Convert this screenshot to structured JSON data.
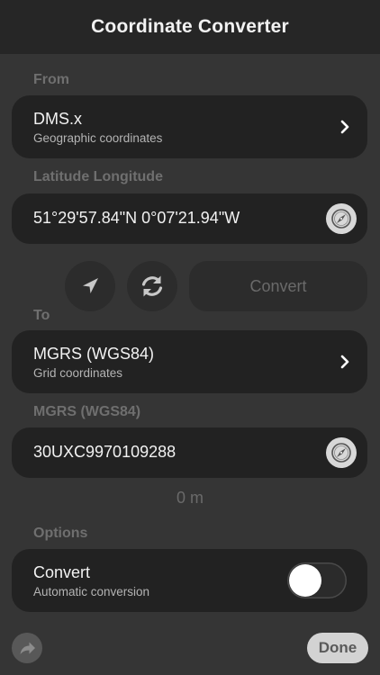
{
  "header": {
    "title": "Coordinate Converter"
  },
  "from": {
    "section_label": "From",
    "format_title": "DMS.x",
    "format_subtitle": "Geographic coordinates",
    "field_label": "Latitude Longitude",
    "value": "51°29'57.84\"N 0°07'21.94\"W"
  },
  "actions": {
    "location_icon": "location-arrow-icon",
    "swap_icon": "refresh-icon",
    "convert_label": "Convert"
  },
  "to": {
    "section_label": "To",
    "format_title": "MGRS (WGS84)",
    "format_subtitle": "Grid coordinates",
    "field_label": "MGRS (WGS84)",
    "value": "30UXC9970109288",
    "distance": "0 m"
  },
  "options": {
    "section_label": "Options",
    "auto_title": "Convert",
    "auto_subtitle": "Automatic conversion",
    "auto_enabled": false
  },
  "footer": {
    "share_icon": "share-arrow-icon",
    "done_label": "Done"
  },
  "colors": {
    "background": "#353535",
    "header": "#262626",
    "card": "#222222",
    "label": "#6f6f6f"
  }
}
